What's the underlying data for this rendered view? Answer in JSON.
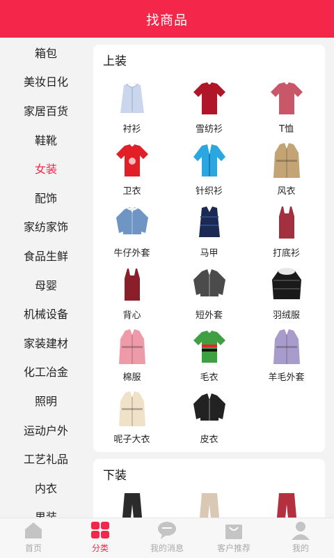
{
  "header": {
    "title": "找商品"
  },
  "sidebar": {
    "items": [
      {
        "label": "箱包"
      },
      {
        "label": "美妆日化"
      },
      {
        "label": "家居百货"
      },
      {
        "label": "鞋靴"
      },
      {
        "label": "女装",
        "active": true
      },
      {
        "label": "配饰"
      },
      {
        "label": "家纺家饰"
      },
      {
        "label": "食品生鲜"
      },
      {
        "label": "母婴"
      },
      {
        "label": "机械设备"
      },
      {
        "label": "家装建材"
      },
      {
        "label": "化工冶金"
      },
      {
        "label": "照明"
      },
      {
        "label": "运动户外"
      },
      {
        "label": "工艺礼品"
      },
      {
        "label": "内衣"
      },
      {
        "label": "男装"
      }
    ]
  },
  "sections": [
    {
      "title": "上装",
      "items": [
        {
          "label": "衬衫",
          "icon": "shirt-icon",
          "color": "#c9d6ee"
        },
        {
          "label": "雪纺衫",
          "icon": "blouse-icon",
          "color": "#b01628"
        },
        {
          "label": "T恤",
          "icon": "tshirt-icon",
          "color": "#c8576a"
        },
        {
          "label": "卫衣",
          "icon": "sweatshirt-icon",
          "color": "#e21f26"
        },
        {
          "label": "针织衫",
          "icon": "cardigan-icon",
          "color": "#2aa6e0"
        },
        {
          "label": "风衣",
          "icon": "trench-coat-icon",
          "color": "#c4a374"
        },
        {
          "label": "牛仔外套",
          "icon": "denim-jacket-icon",
          "color": "#6e95c4"
        },
        {
          "label": "马甲",
          "icon": "vest-icon",
          "color": "#1a2a55"
        },
        {
          "label": "打底衫",
          "icon": "camisole-icon",
          "color": "#a3303f"
        },
        {
          "label": "背心",
          "icon": "tank-top-icon",
          "color": "#8a1f2a"
        },
        {
          "label": "短外套",
          "icon": "short-jacket-icon",
          "color": "#4b4b4b"
        },
        {
          "label": "羽绒服",
          "icon": "down-jacket-icon",
          "color": "#1a1a1a"
        },
        {
          "label": "棉服",
          "icon": "padded-coat-icon",
          "color": "#ee9aa8"
        },
        {
          "label": "毛衣",
          "icon": "sweater-icon",
          "color": "#3fa043"
        },
        {
          "label": "羊毛外套",
          "icon": "wool-coat-icon",
          "color": "#a79ccc"
        },
        {
          "label": "呢子大衣",
          "icon": "overcoat-icon",
          "color": "#efe2c8"
        },
        {
          "label": "皮衣",
          "icon": "leather-jacket-icon",
          "color": "#222222"
        }
      ]
    },
    {
      "title": "下装",
      "items": [
        {
          "label": "",
          "icon": "jeans-icon",
          "color": "#2b2b2b"
        },
        {
          "label": "",
          "icon": "wide-pants-icon",
          "color": "#d8c8b4"
        },
        {
          "label": "",
          "icon": "red-pants-icon",
          "color": "#b5303f"
        }
      ]
    }
  ],
  "tabbar": {
    "tabs": [
      {
        "label": "首页",
        "icon": "home-icon",
        "active": false
      },
      {
        "label": "分类",
        "icon": "category-icon",
        "active": true
      },
      {
        "label": "我的消息",
        "icon": "message-icon",
        "active": false
      },
      {
        "label": "客户推荐",
        "icon": "bag-icon",
        "active": false
      },
      {
        "label": "我的",
        "icon": "user-icon",
        "active": false
      }
    ]
  },
  "colors": {
    "accent": "#f4264a",
    "inactive": "#aaaaaa"
  }
}
